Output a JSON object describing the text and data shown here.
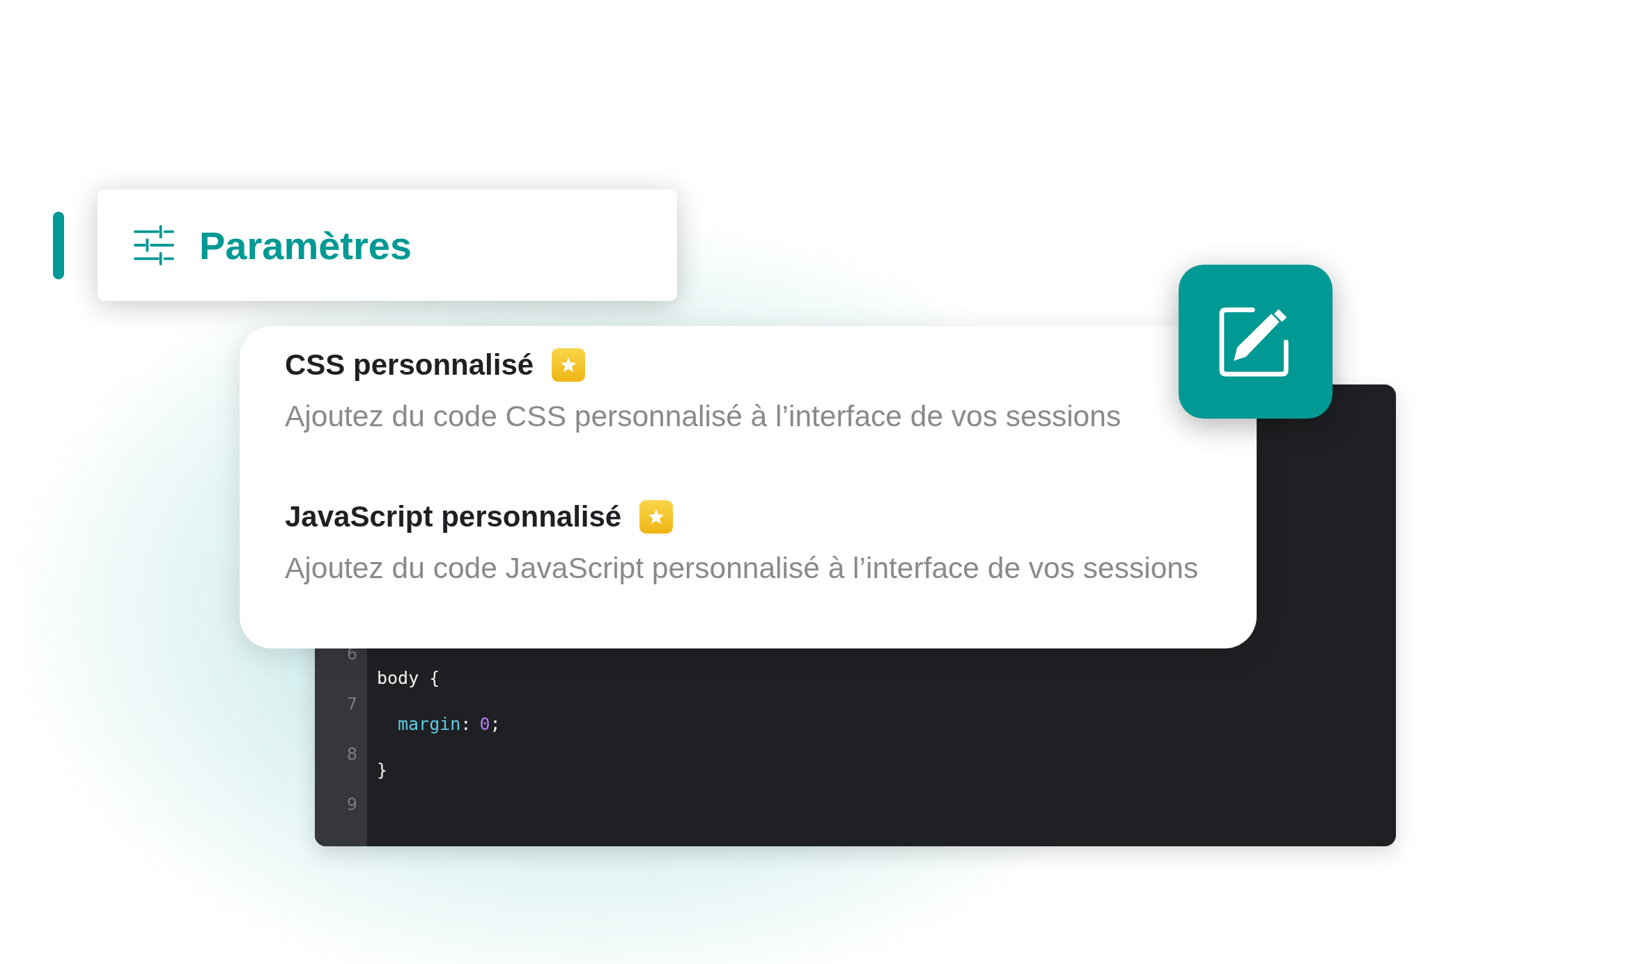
{
  "sidebar_item": {
    "label": "Paramètres",
    "selected": true
  },
  "settings": [
    {
      "title": "CSS personnalisé",
      "premium": true,
      "description": "Ajoutez du code CSS personnalisé à l’interface de vos sessions"
    },
    {
      "title": "JavaScript personnalisé",
      "premium": true,
      "description": "Ajoutez du code JavaScript personnalisé à l’interface de vos sessions"
    }
  ],
  "editor": {
    "line_numbers": [
      "6",
      "7",
      "8",
      "9"
    ],
    "lines": [
      {
        "indent": false,
        "tokens": [
          {
            "kind": "plain",
            "text": "body {"
          }
        ]
      },
      {
        "indent": true,
        "tokens": [
          {
            "kind": "property",
            "text": "margin"
          },
          {
            "kind": "plain",
            "text": ":"
          },
          {
            "kind": "number",
            "text": "0"
          },
          {
            "kind": "plain",
            "text": ";"
          }
        ]
      },
      {
        "indent": false,
        "tokens": [
          {
            "kind": "plain",
            "text": "}"
          }
        ]
      }
    ]
  }
}
